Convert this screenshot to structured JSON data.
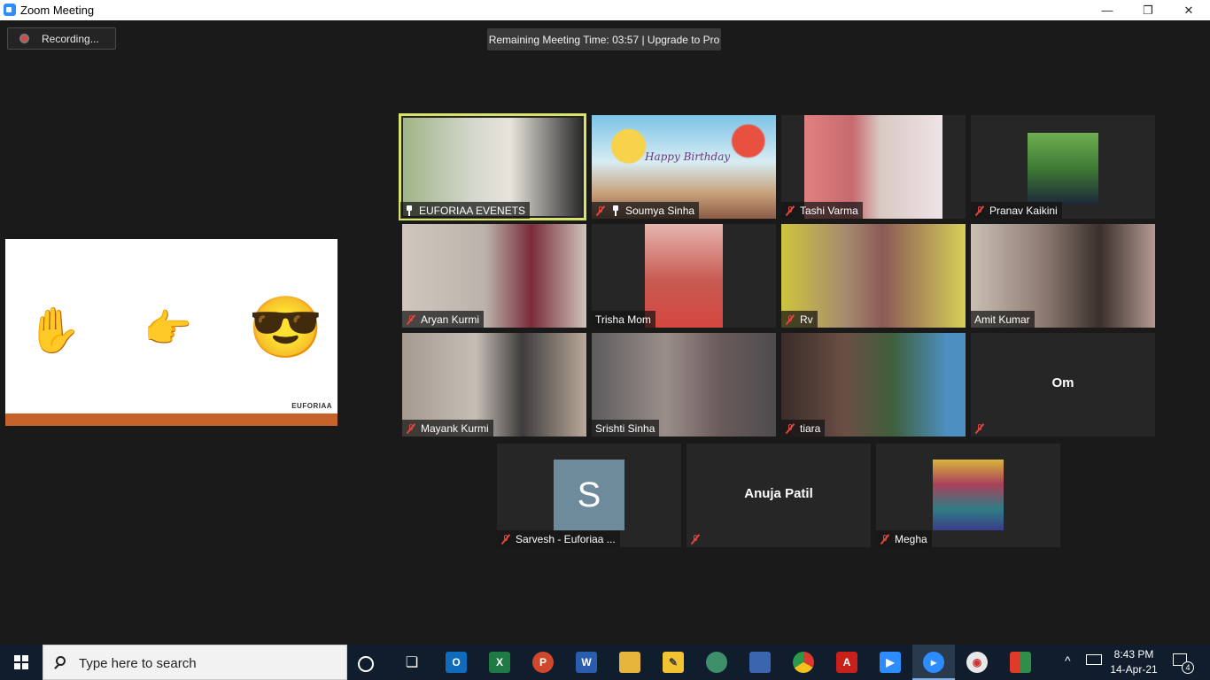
{
  "window": {
    "title": "Zoom Meeting",
    "minimize": "—",
    "maximize": "❐",
    "close": "✕"
  },
  "recording": {
    "label": "Recording..."
  },
  "banner": {
    "text": "Remaining Meeting Time: 03:57 | Upgrade to Pro"
  },
  "share": {
    "emoji_hand": "✋",
    "emoji_point": "👉",
    "emoji_cool": "😎",
    "brand": "EUFORIAA"
  },
  "video_panel": {
    "banner_text": "Happy Birthday"
  },
  "participants": [
    {
      "name": "EUFORIAA EVENETS",
      "icon": "pin-icon",
      "bg": "#6f8c55"
    },
    {
      "name": "Soumya Sinha",
      "icon": "mute-icon,pin-icon",
      "bg": "#7ab6d6"
    },
    {
      "name": "Tashi Varma",
      "icon": "mute-icon",
      "bg": "#c98a8e"
    },
    {
      "name": "Pranav Kaikini",
      "icon": "mute-icon",
      "bg": "#3c6a36"
    },
    {
      "name": "Aryan Kurmi",
      "icon": "mute-icon",
      "bg": "#a39a94"
    },
    {
      "name": "Trisha Mom",
      "icon": "none",
      "bg": "#b04a46"
    },
    {
      "name": "Rv",
      "icon": "mute-icon",
      "bg": "#c9be4c"
    },
    {
      "name": "Amit Kumar",
      "icon": "none",
      "bg": "#6e5a56"
    },
    {
      "name": "Mayank Kurmi",
      "icon": "mute-icon",
      "bg": "#8a7c72"
    },
    {
      "name": "Srishti Sinha",
      "icon": "none",
      "bg": "#6d6a6c"
    },
    {
      "name": "tiara",
      "icon": "mute-icon",
      "bg": "#5d4c46"
    },
    {
      "name": "Om",
      "icon": "mute-icon",
      "bg": "#262626"
    },
    {
      "name": "Sarvesh - Euforiaa ...",
      "icon": "mute-icon",
      "avatar_letter": "S"
    },
    {
      "name": "Anuja Patil",
      "icon": "mute-icon",
      "bg": "#262626"
    },
    {
      "name": "Megha",
      "icon": "mute-icon",
      "bg": "#3f7f86"
    }
  ],
  "taskbar": {
    "search_placeholder": "Type here to search",
    "apps": [
      "task-view",
      "outlook",
      "excel",
      "powerpoint",
      "word",
      "file-explorer",
      "sticky-notes",
      "network",
      "remote-desktop",
      "chrome",
      "acrobat",
      "zoom-video",
      "zoom",
      "media-player",
      "paint"
    ],
    "time": "8:43 PM",
    "date": "14-Apr-21",
    "notification_count": "4"
  },
  "colors": {
    "active_speaker": "#d8e36a",
    "mute_red": "#e0453f",
    "share_band": "#c5632a"
  }
}
